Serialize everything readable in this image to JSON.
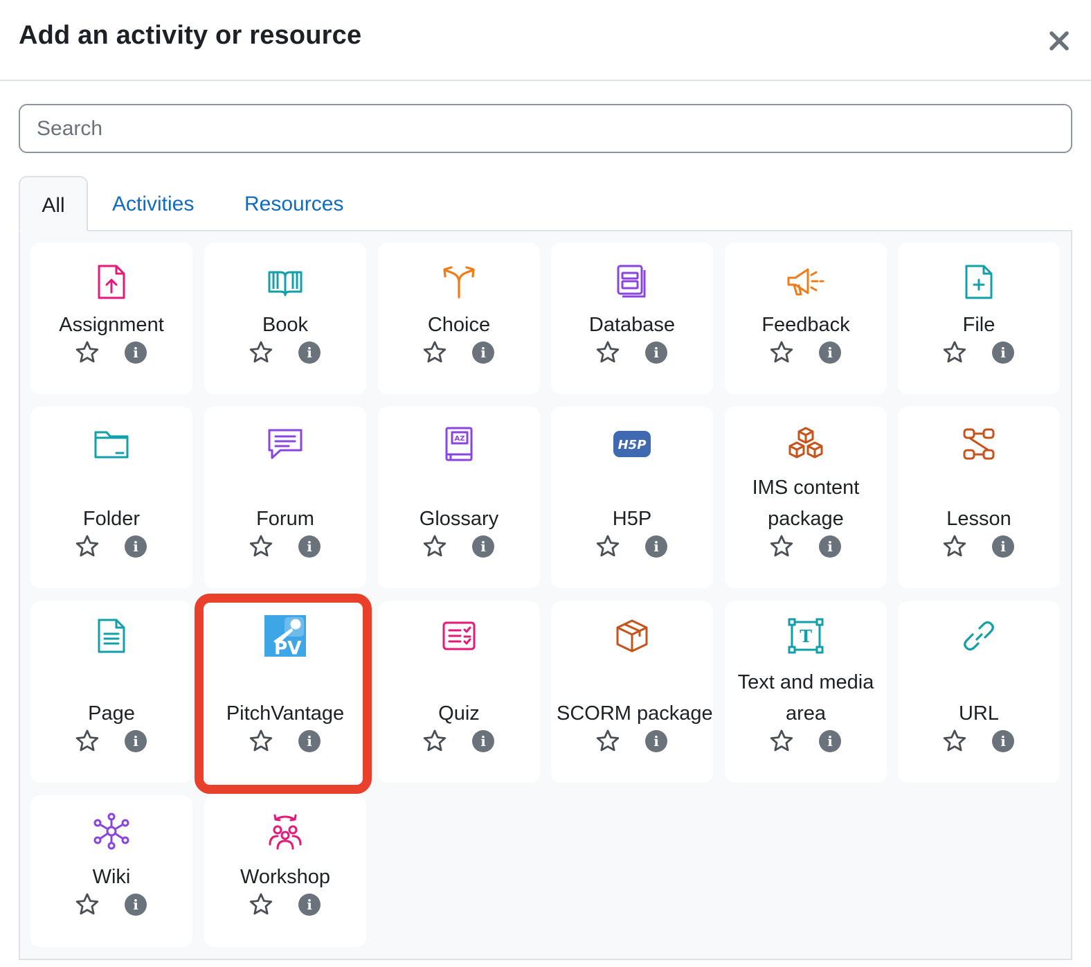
{
  "modal": {
    "title": "Add an activity or resource",
    "close_label": "×"
  },
  "search": {
    "placeholder": "Search",
    "value": ""
  },
  "tabs": [
    {
      "label": "All",
      "active": true
    },
    {
      "label": "Activities",
      "active": false
    },
    {
      "label": "Resources",
      "active": false
    }
  ],
  "items": [
    {
      "name": "Assignment",
      "icon": "assignment-upload-icon",
      "color": "#e6197b"
    },
    {
      "name": "Book",
      "icon": "book-icon",
      "color": "#11a0a9"
    },
    {
      "name": "Choice",
      "icon": "choice-arrows-icon",
      "color": "#f07b17"
    },
    {
      "name": "Database",
      "icon": "database-icon",
      "color": "#8a44e0"
    },
    {
      "name": "Feedback",
      "icon": "megaphone-icon",
      "color": "#f07b17"
    },
    {
      "name": "File",
      "icon": "file-plus-icon",
      "color": "#11a0a9"
    },
    {
      "name": "Folder",
      "icon": "folder-icon",
      "color": "#11a0a9"
    },
    {
      "name": "Forum",
      "icon": "forum-chat-icon",
      "color": "#8a44e0"
    },
    {
      "name": "Glossary",
      "icon": "glossary-az-icon",
      "color": "#8a44e0"
    },
    {
      "name": "H5P",
      "icon": "h5p-icon",
      "color": "#3f6ab1",
      "icon_text": "H5P"
    },
    {
      "name": "IMS content package",
      "icon": "package-cubes-icon",
      "color": "#c7531b"
    },
    {
      "name": "Lesson",
      "icon": "lesson-flow-icon",
      "color": "#c7531b"
    },
    {
      "name": "Page",
      "icon": "page-document-icon",
      "color": "#11a0a9"
    },
    {
      "name": "PitchVantage",
      "icon": "pitchvantage-microphone-icon",
      "color": "#3da6e6",
      "icon_text": "PV"
    },
    {
      "name": "Quiz",
      "icon": "quiz-checklist-icon",
      "color": "#e6197b"
    },
    {
      "name": "SCORM package",
      "icon": "scorm-box-icon",
      "color": "#c7531b"
    },
    {
      "name": "Text and media area",
      "icon": "text-media-icon",
      "color": "#11a0a9",
      "icon_text": "T"
    },
    {
      "name": "URL",
      "icon": "link-icon",
      "color": "#11a0a9"
    },
    {
      "name": "Wiki",
      "icon": "wiki-network-icon",
      "color": "#8a44e0"
    },
    {
      "name": "Workshop",
      "icon": "workshop-people-icon",
      "color": "#e6197b"
    }
  ],
  "highlighted_item": "PitchVantage",
  "highlight_color": "#e8402a",
  "link_color": "#0f6cbf"
}
